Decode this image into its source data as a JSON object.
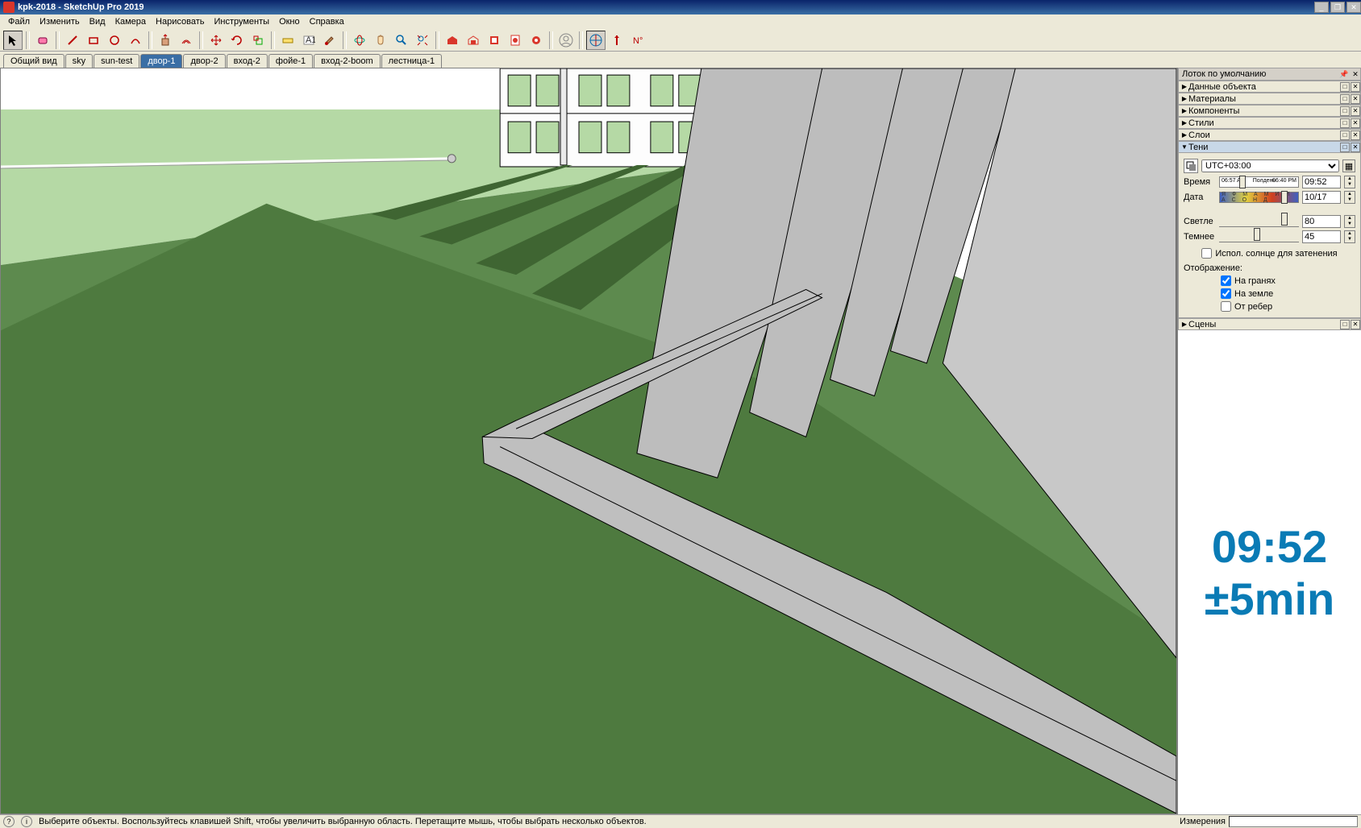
{
  "window": {
    "title": "kpk-2018 - SketchUp Pro 2019"
  },
  "menu": {
    "items": [
      "Файл",
      "Изменить",
      "Вид",
      "Камера",
      "Нарисовать",
      "Инструменты",
      "Окно",
      "Справка"
    ]
  },
  "scene_tabs": {
    "items": [
      "Общий вид",
      "sky",
      "sun-test",
      "двор-1",
      "двор-2",
      "вход-2",
      "фойе-1",
      "вход-2-boom",
      "лестница-1"
    ],
    "active": "двор-1"
  },
  "tray": {
    "title": "Лоток по умолчанию",
    "panels": [
      "Данные объекта",
      "Материалы",
      "Компоненты",
      "Стили",
      "Слои",
      "Тени"
    ],
    "expanded": "Тени",
    "bottom_panel": "Сцены"
  },
  "shadows": {
    "timezone": "UTC+03:00",
    "time_label": "Время",
    "time_value": "09:52",
    "time_marks": {
      "left": "06:57 AM",
      "middle": "Полдень",
      "right": "06:40 PM"
    },
    "date_label": "Дата",
    "date_value": "10/17",
    "date_marks": "Я Ф М А М И И А С О Н Д",
    "light_label": "Светле",
    "light_value": "80",
    "dark_label": "Темнее",
    "dark_value": "45",
    "use_sun": "Испол. солнце для затенения",
    "display_label": "Отображение:",
    "on_faces": "На гранях",
    "on_faces_checked": true,
    "on_ground": "На земле",
    "on_ground_checked": true,
    "from_edges": "От ребер",
    "from_edges_checked": false
  },
  "overlay": {
    "line1": "09:52",
    "line2": "±5min"
  },
  "status": {
    "hint": "Выберите объекты. Воспользуйтесь клавишей Shift, чтобы увеличить выбранную область. Перетащите мышь, чтобы выбрать несколько объектов.",
    "measure_label": "Измерения"
  }
}
